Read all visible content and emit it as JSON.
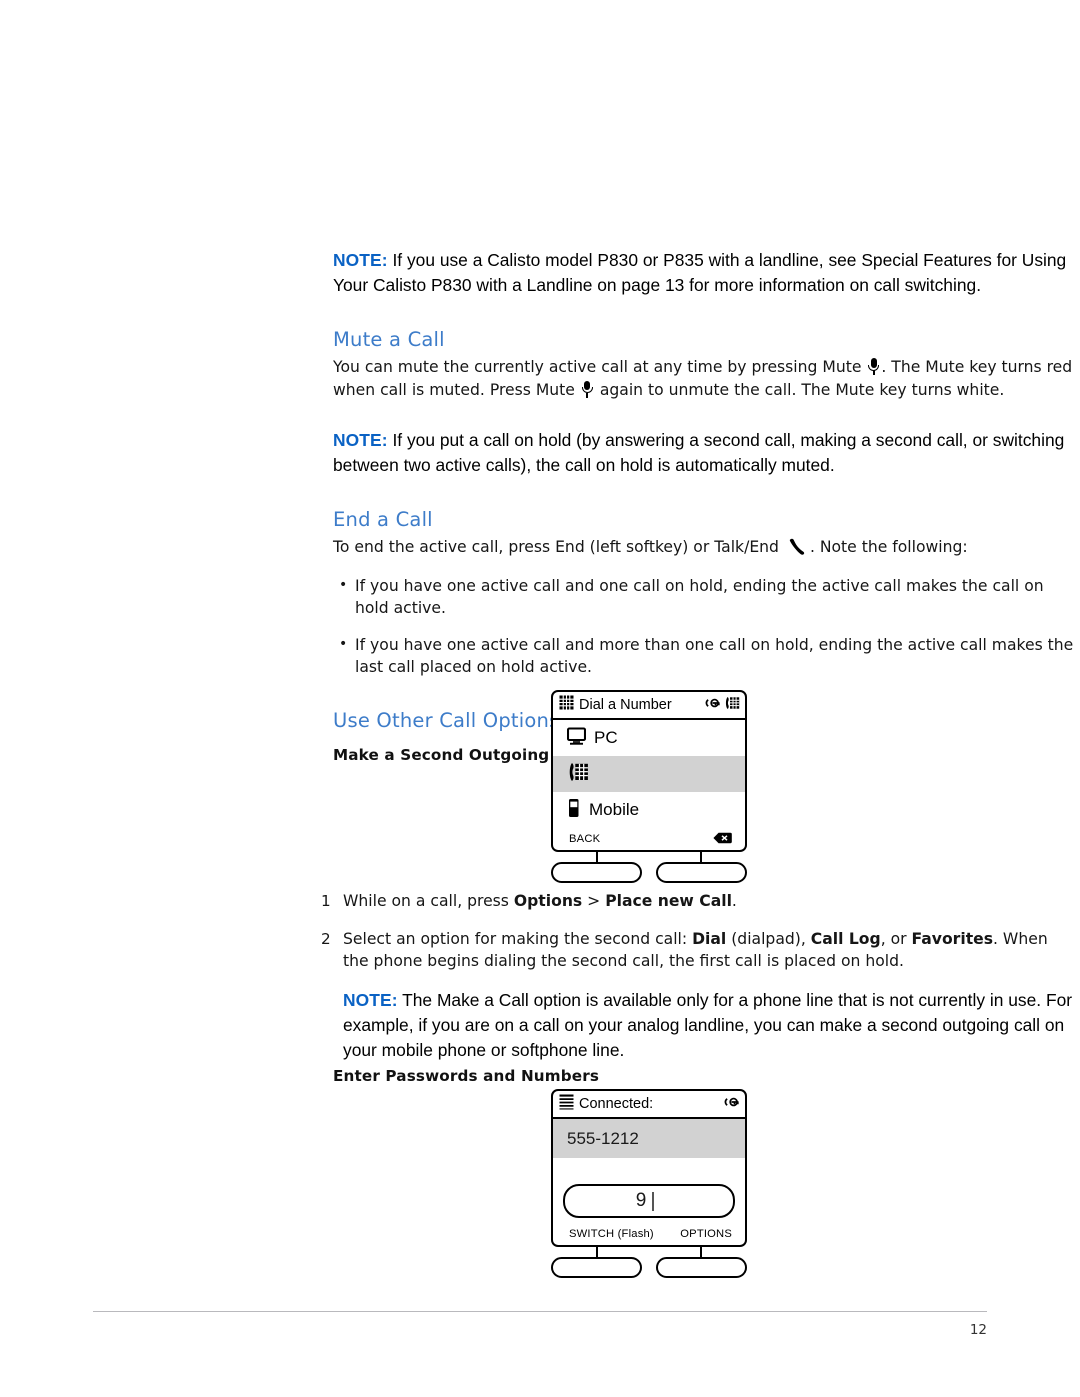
{
  "document": {
    "page_number": "12"
  },
  "notes": {
    "label": "NOTE:",
    "note1_text": "If you use a Calisto model P830 or P835 with a landline, see Special Features for Using Your Calisto P830 with a Landline on page 13 for more information on call switching.",
    "note2_text": "If you put a call on hold (by answering a second call, making a second call, or switching between two active calls), the call on hold is automatically muted.",
    "note3_text": "The Make a Call option is available only for a phone line that is not currently in use. For example, if you are on a call on your analog landline, you can make a second outgoing call on your mobile phone or softphone line."
  },
  "sections": {
    "mute": {
      "heading": "Mute a Call",
      "body_part1": "You can mute the currently active call at any time by pressing Mute",
      "body_part2": ". The Mute key turns red when call is muted. Press Mute",
      "body_part3": "again to unmute the call. The Mute key turns white."
    },
    "end": {
      "heading": "End a Call",
      "body_part1": "To end the active call, press End (left softkey) or Talk/End",
      "body_part2": ". Note the following:",
      "bullets": [
        "If you have one active call and one call on hold, ending the active call makes the call on hold active.",
        "If you have one active call and more than one call on hold, ending the active call makes the last call placed on hold active."
      ]
    },
    "other_options": {
      "heading": "Use Other Call Options",
      "subhead_make_call": "Make a Second Outgoing Call",
      "subhead_passwords": "Enter Passwords and Numbers"
    }
  },
  "steps": [
    {
      "num": "1",
      "parts": [
        {
          "text": "While on a call, press ",
          "bold": false
        },
        {
          "text": "Options",
          "bold": true
        },
        {
          "text": " > ",
          "bold": false
        },
        {
          "text": "Place new Call",
          "bold": true
        },
        {
          "text": ".",
          "bold": false
        }
      ]
    },
    {
      "num": "2",
      "parts": [
        {
          "text": "Select an option for making the second call: ",
          "bold": false
        },
        {
          "text": "Dial",
          "bold": true
        },
        {
          "text": " (dialpad), ",
          "bold": false
        },
        {
          "text": "Call Log",
          "bold": true
        },
        {
          "text": ", or ",
          "bold": false
        },
        {
          "text": "Favorites",
          "bold": true
        },
        {
          "text": ". When the phone begins dialing the second call, the first call is placed on hold.",
          "bold": false
        }
      ]
    }
  ],
  "phone_display_1": {
    "title": "Dial a Number",
    "title_icon": "dialpad-grid-icon",
    "right_icon_1": "call-key-icon",
    "right_icon_2": "desk-phone-icon",
    "rows": [
      {
        "label": "PC",
        "icon": "monitor-icon",
        "selected": false
      },
      {
        "label": "",
        "icon": "desk-phone-icon",
        "selected": true
      },
      {
        "label": "Mobile",
        "icon": "mobile-phone-icon",
        "selected": false
      }
    ],
    "softkey_left_label": "BACK",
    "softkey_right_label": "",
    "softkey_right_icon": "backspace-delete-icon"
  },
  "phone_display_2": {
    "title": "Connected:",
    "title_icon": "landline-lines-icon",
    "right_icon_1": "call-key-icon",
    "number": "555-1212",
    "entry_value": "9",
    "softkey_left_label": "SWITCH (Flash)",
    "softkey_right_label": "OPTIONS"
  },
  "colors": {
    "heading_blue": "#3d7cc9",
    "note_blue": "#0a62c4",
    "selection_gray": "#d2d2d2",
    "rule_gray": "#b9b9bd"
  }
}
